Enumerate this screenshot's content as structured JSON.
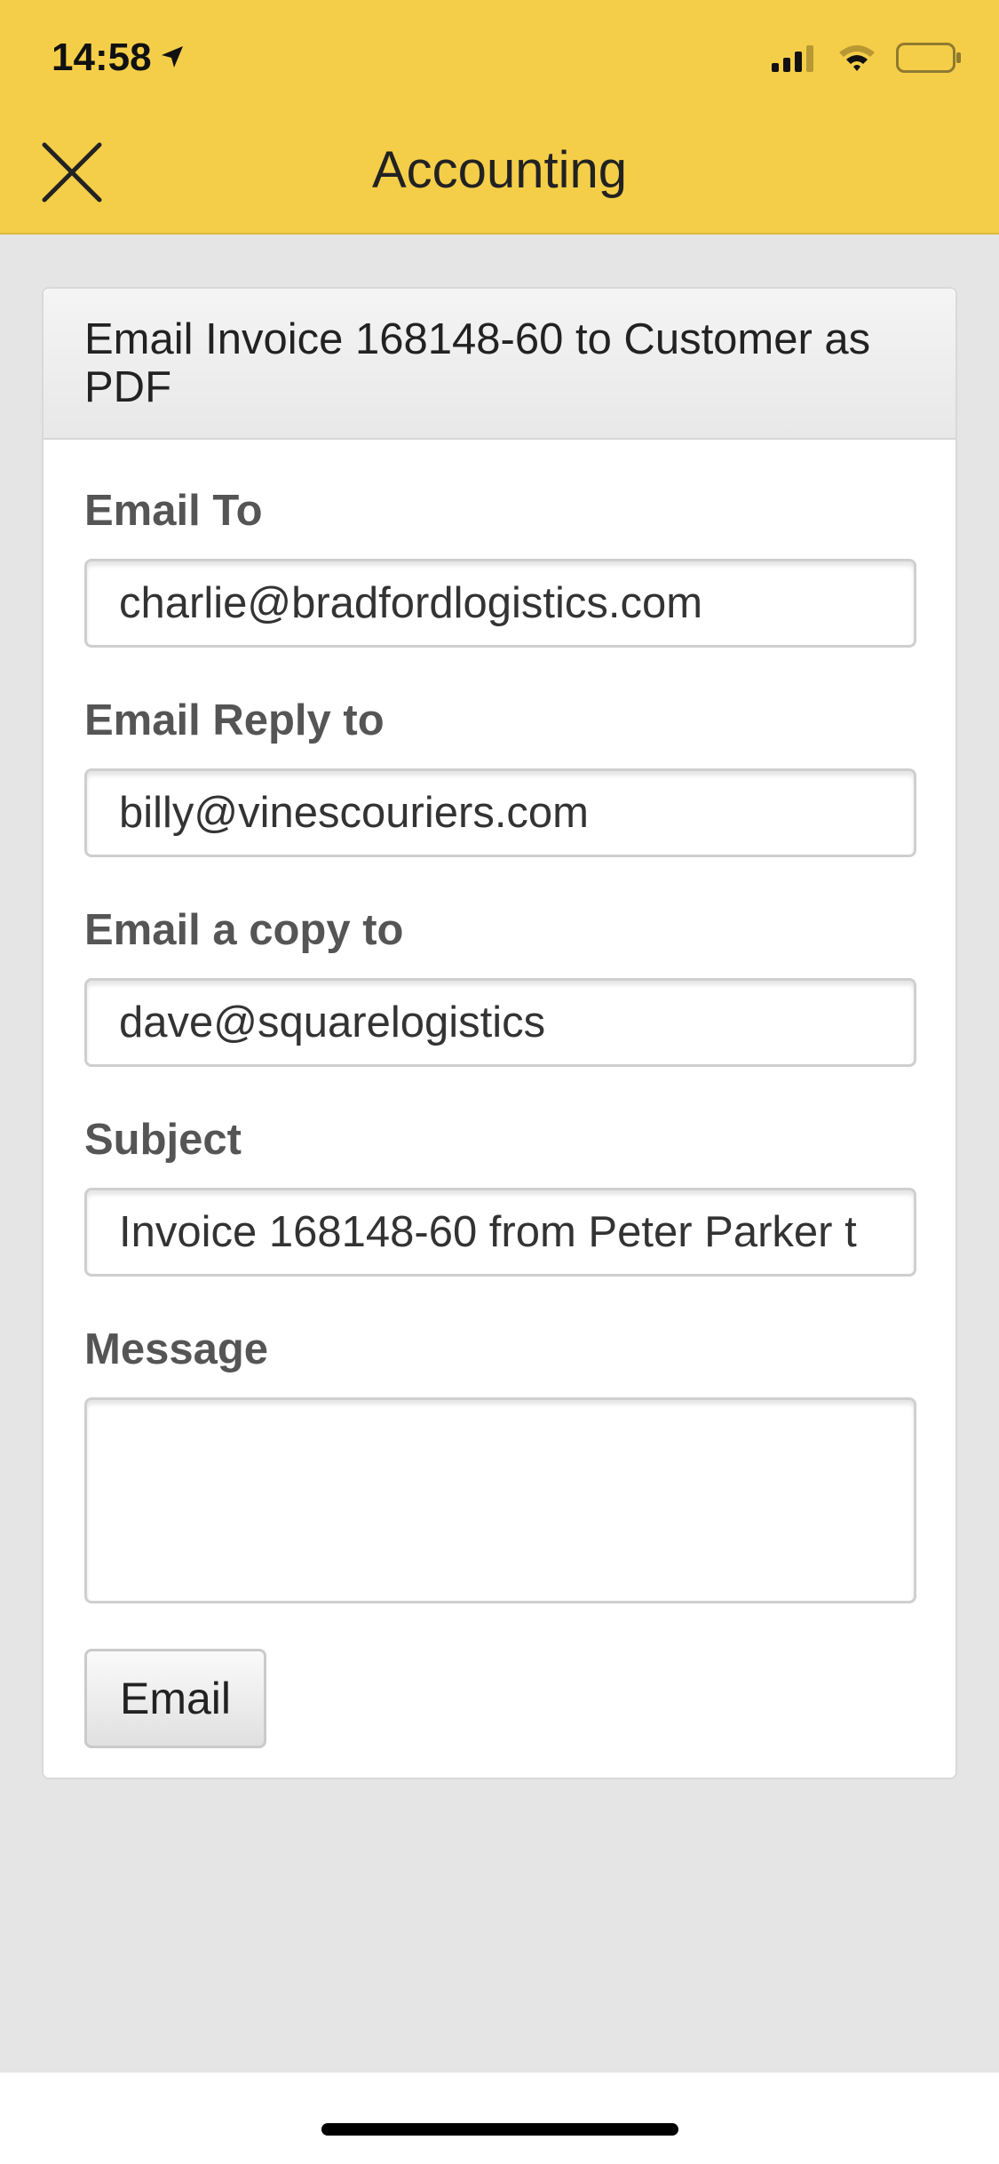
{
  "status_bar": {
    "time": "14:58",
    "icons": [
      "location-arrow-icon",
      "cellular-signal-icon",
      "wifi-icon",
      "battery-icon"
    ]
  },
  "header": {
    "title": "Accounting",
    "close_icon": "close-icon",
    "background_color": "#f5ce49"
  },
  "card": {
    "title": "Email Invoice 168148-60 to Customer as PDF"
  },
  "form": {
    "email_to": {
      "label": "Email To",
      "value": "charlie@bradfordlogistics.com"
    },
    "reply_to": {
      "label": "Email Reply to",
      "value": "billy@vinescouriers.com"
    },
    "copy_to": {
      "label": "Email a copy to",
      "value": "dave@squarelogistics"
    },
    "subject": {
      "label": "Subject",
      "value": "Invoice 168148-60 from Peter Parker t"
    },
    "message": {
      "label": "Message",
      "value": ""
    },
    "submit_label": "Email"
  }
}
